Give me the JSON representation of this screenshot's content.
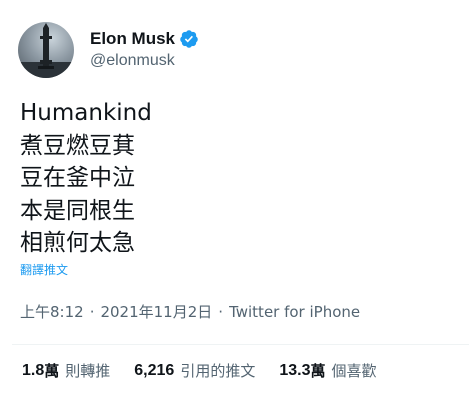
{
  "author": {
    "display_name": "Elon Musk",
    "handle": "@elonmusk",
    "verified_icon": "verified-badge-icon",
    "avatar_icon": "starship-avatar"
  },
  "tweet": {
    "text": "Humankind\n煮豆燃豆萁\n豆在釜中泣\n本是同根生\n相煎何太急",
    "translate_label": "翻譯推文"
  },
  "meta": {
    "time": "上午8:12",
    "separator": "·",
    "date": "2021年11月2日",
    "source": "Twitter for iPhone"
  },
  "stats": [
    {
      "count": "1.8",
      "unit": "萬",
      "label": "則轉推"
    },
    {
      "count": "6,216",
      "unit": "",
      "label": "引用的推文"
    },
    {
      "count": "13.3",
      "unit": "萬",
      "label": "個喜歡"
    }
  ],
  "colors": {
    "accent": "#1d9bf0",
    "secondary_text": "#536471",
    "primary_text": "#0f1419"
  }
}
